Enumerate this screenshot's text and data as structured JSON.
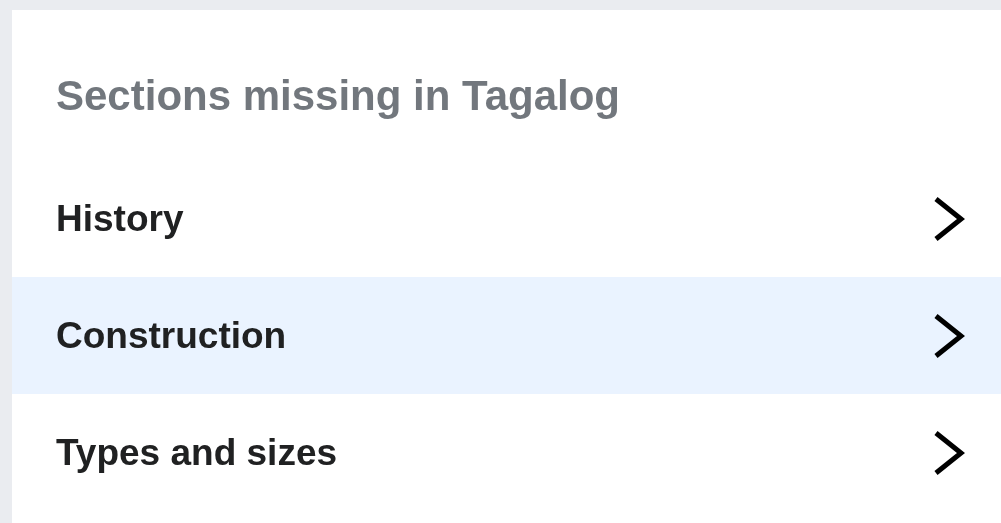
{
  "section_title": "Sections missing in Tagalog",
  "sections": [
    {
      "label": "History",
      "selected": false
    },
    {
      "label": "Construction",
      "selected": true
    },
    {
      "label": "Types and sizes",
      "selected": false
    }
  ]
}
